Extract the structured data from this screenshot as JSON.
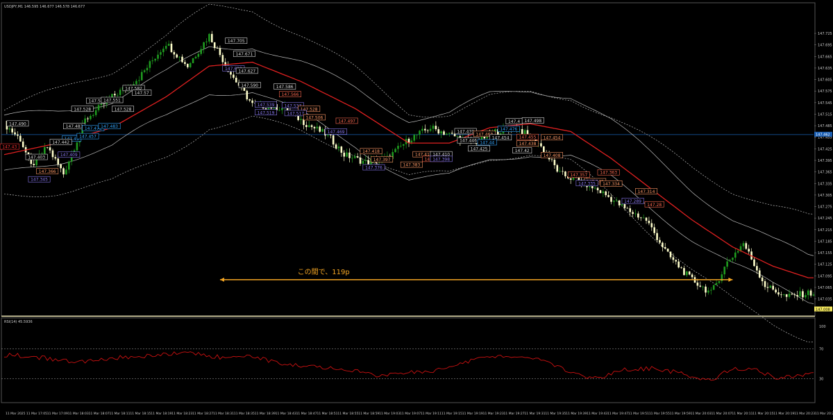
{
  "header": {
    "symbol_line": "USDJPY,M1  146.595 146.677 146.578 146.677",
    "rsi_label": "RSI(14) 45.5936"
  },
  "annotation": {
    "text": "この間で、119p"
  },
  "colors": {
    "background": "#000000",
    "bull": "#1f9b1f",
    "bear": "#ffffcc",
    "ma": "#e02020",
    "band": "#bdbdbd",
    "hline": "#1a5fb4",
    "annotation": "#f5a623",
    "rsi": "#cc1111"
  },
  "chart_data": [
    {
      "type": "candlestick",
      "title": "",
      "ylim": [
        147.0,
        147.79
      ],
      "price_ticks": [
        "147.725",
        "147.695",
        "147.665",
        "147.635",
        "147.605",
        "147.575",
        "147.545",
        "147.515",
        "147.485",
        "147.455",
        "147.425",
        "147.395",
        "147.365",
        "147.335",
        "147.305",
        "147.275",
        "147.245",
        "147.215",
        "147.185",
        "147.155",
        "147.125",
        "147.095",
        "147.065",
        "147.035"
      ],
      "hline": {
        "value": 147.462,
        "label": "147.462"
      },
      "current_price": {
        "value": 147.008,
        "label": "147.008"
      },
      "close_path": [
        [
          0,
          147.49
        ],
        [
          6,
          147.45
        ],
        [
          10,
          147.38
        ],
        [
          16,
          147.43
        ],
        [
          22,
          147.36
        ],
        [
          30,
          147.5
        ],
        [
          40,
          147.56
        ],
        [
          50,
          147.61
        ],
        [
          60,
          147.7
        ],
        [
          68,
          147.64
        ],
        [
          76,
          147.72
        ],
        [
          84,
          147.62
        ],
        [
          92,
          147.54
        ],
        [
          104,
          147.53
        ],
        [
          112,
          147.49
        ],
        [
          120,
          147.46
        ],
        [
          126,
          147.41
        ],
        [
          134,
          147.39
        ],
        [
          142,
          147.4
        ],
        [
          150,
          147.45
        ],
        [
          158,
          147.48
        ],
        [
          166,
          147.46
        ],
        [
          174,
          147.44
        ],
        [
          182,
          147.47
        ],
        [
          190,
          147.48
        ],
        [
          198,
          147.44
        ],
        [
          206,
          147.36
        ],
        [
          214,
          147.34
        ],
        [
          222,
          147.31
        ],
        [
          230,
          147.27
        ],
        [
          238,
          147.24
        ],
        [
          246,
          147.15
        ],
        [
          254,
          147.09
        ],
        [
          262,
          147.05
        ],
        [
          268,
          147.13
        ],
        [
          274,
          147.18
        ],
        [
          282,
          147.07
        ],
        [
          290,
          147.04
        ],
        [
          298,
          147.05
        ]
      ],
      "ma_path": [
        [
          0,
          147.41
        ],
        [
          20,
          147.44
        ],
        [
          40,
          147.48
        ],
        [
          60,
          147.56
        ],
        [
          76,
          147.64
        ],
        [
          92,
          147.65
        ],
        [
          110,
          147.6
        ],
        [
          130,
          147.53
        ],
        [
          150,
          147.44
        ],
        [
          165,
          147.44
        ],
        [
          180,
          147.48
        ],
        [
          195,
          147.49
        ],
        [
          210,
          147.47
        ],
        [
          225,
          147.4
        ],
        [
          240,
          147.32
        ],
        [
          255,
          147.24
        ],
        [
          270,
          147.17
        ],
        [
          285,
          147.12
        ],
        [
          298,
          147.09
        ]
      ],
      "labels": [
        {
          "i": 86,
          "v": 147.705,
          "text": "147.705",
          "c": "#dddddd"
        },
        {
          "i": 89,
          "v": 147.671,
          "text": "147.671",
          "c": "#dddddd"
        },
        {
          "i": 85,
          "v": 147.633,
          "text": "147.633",
          "c": "#8877ee"
        },
        {
          "i": 90,
          "v": 147.627,
          "text": "147.627",
          "c": "#dddddd"
        },
        {
          "i": 91,
          "v": 147.59,
          "text": "147.590",
          "c": "#dddddd"
        },
        {
          "i": 104,
          "v": 147.586,
          "text": "147.586",
          "c": "#dddddd"
        },
        {
          "i": 106,
          "v": 147.566,
          "text": "147.566",
          "c": "#ff6a50"
        },
        {
          "i": 97,
          "v": 147.539,
          "text": "147.539",
          "c": "#8877ee"
        },
        {
          "i": 107,
          "v": 147.537,
          "text": "147.537",
          "c": "#8877ee"
        },
        {
          "i": 97,
          "v": 147.519,
          "text": "147.519",
          "c": "#8877ee"
        },
        {
          "i": 113,
          "v": 147.528,
          "text": "147.528",
          "c": "#ff9966"
        },
        {
          "i": 108,
          "v": 147.517,
          "text": "147.517",
          "c": "#8877ee"
        },
        {
          "i": 115,
          "v": 147.506,
          "text": "147.506",
          "c": "#ff9966"
        },
        {
          "i": 127,
          "v": 147.497,
          "text": "147.497",
          "c": "#ff6a50"
        },
        {
          "i": 123,
          "v": 147.469,
          "text": "147.469",
          "c": "#8877ee"
        },
        {
          "i": 136,
          "v": 147.418,
          "text": "147.418",
          "c": "#ff9966"
        },
        {
          "i": 140,
          "v": 147.397,
          "text": "147.397",
          "c": "#ff9966"
        },
        {
          "i": 137,
          "v": 147.376,
          "text": "147.376",
          "c": "#8877ee"
        },
        {
          "i": 155,
          "v": 147.41,
          "text": "147.41",
          "c": "#ff9966"
        },
        {
          "i": 162,
          "v": 147.41,
          "text": "147.410",
          "c": "#dddddd"
        },
        {
          "i": 159,
          "v": 147.398,
          "text": "147.398",
          "c": "#ff6a50"
        },
        {
          "i": 162,
          "v": 147.398,
          "text": "147.398",
          "c": "#8877ee"
        },
        {
          "i": 151,
          "v": 147.383,
          "text": "147.383",
          "c": "#ff9966"
        },
        {
          "i": 171,
          "v": 147.47,
          "text": "147.470",
          "c": "#dddddd"
        },
        {
          "i": 172,
          "v": 147.446,
          "text": "147.446",
          "c": "#dddddd"
        },
        {
          "i": 178,
          "v": 147.463,
          "text": "147.463",
          "c": "#ff9966"
        },
        {
          "i": 187,
          "v": 147.476,
          "text": "147.476",
          "c": "#33a6ff"
        },
        {
          "i": 184,
          "v": 147.454,
          "text": "147.454",
          "c": "#dddddd"
        },
        {
          "i": 179,
          "v": 147.441,
          "text": "147.44",
          "c": "#33a6ff"
        },
        {
          "i": 176,
          "v": 147.425,
          "text": "147.425",
          "c": "#dddddd"
        },
        {
          "i": 192,
          "v": 147.42,
          "text": "147.42",
          "c": "#dddddd"
        },
        {
          "i": 189,
          "v": 147.496,
          "text": "147.4",
          "c": "#dddddd"
        },
        {
          "i": 196,
          "v": 147.498,
          "text": "147.498",
          "c": "#dddddd"
        },
        {
          "i": 194,
          "v": 147.455,
          "text": "147.455",
          "c": "#ff6a50"
        },
        {
          "i": 203,
          "v": 147.454,
          "text": "147.454",
          "c": "#ff9966"
        },
        {
          "i": 194,
          "v": 147.438,
          "text": "147.438",
          "c": "#ff9966"
        },
        {
          "i": 203,
          "v": 147.408,
          "text": "147.408",
          "c": "#ff9966"
        },
        {
          "i": 213,
          "v": 147.357,
          "text": "147.357",
          "c": "#ff6a50"
        },
        {
          "i": 224,
          "v": 147.363,
          "text": "147.363",
          "c": "#ff6a50"
        },
        {
          "i": 219,
          "v": 147.34,
          "text": "147.340",
          "c": "#ff9966"
        },
        {
          "i": 225,
          "v": 147.334,
          "text": "147.334",
          "c": "#ff9966"
        },
        {
          "i": 216,
          "v": 147.335,
          "text": "147.335",
          "c": "#8877ee"
        },
        {
          "i": 238,
          "v": 147.314,
          "text": "147.314",
          "c": "#ff9966"
        },
        {
          "i": 233,
          "v": 147.289,
          "text": "147.289",
          "c": "#8877ee"
        },
        {
          "i": 241,
          "v": 147.28,
          "text": "147.28",
          "c": "#ff6a50"
        },
        {
          "i": 29,
          "v": 147.528,
          "text": "147.528",
          "c": "#dddddd"
        },
        {
          "i": 34,
          "v": 147.549,
          "text": "147.54",
          "c": "#dddddd"
        },
        {
          "i": 40,
          "v": 147.551,
          "text": "147.551",
          "c": "#dddddd"
        },
        {
          "i": 48,
          "v": 147.582,
          "text": "147.582",
          "c": "#dddddd"
        },
        {
          "i": 51,
          "v": 147.57,
          "text": "147.57",
          "c": "#dddddd"
        },
        {
          "i": 44,
          "v": 147.528,
          "text": "147.528",
          "c": "#dddddd"
        },
        {
          "i": 26,
          "v": 147.483,
          "text": "147.483",
          "c": "#dddddd"
        },
        {
          "i": 33,
          "v": 147.478,
          "text": "147.478",
          "c": "#33a6ff"
        },
        {
          "i": 39,
          "v": 147.483,
          "text": "147.483",
          "c": "#33a6ff"
        },
        {
          "i": 25,
          "v": 147.451,
          "text": "147.45",
          "c": "#33a6ff"
        },
        {
          "i": 31,
          "v": 147.457,
          "text": "147.457",
          "c": "#33a6ff"
        },
        {
          "i": 21,
          "v": 147.442,
          "text": "147.442",
          "c": "#dddddd"
        },
        {
          "i": 12,
          "v": 147.403,
          "text": "147.403",
          "c": "#dddddd"
        },
        {
          "i": 24,
          "v": 147.409,
          "text": "147.409",
          "c": "#8877ee"
        },
        {
          "i": 5,
          "v": 147.49,
          "text": "147.490",
          "c": "#dddddd"
        },
        {
          "i": 2,
          "v": 147.43,
          "text": "147.43",
          "c": "#ff3030"
        },
        {
          "i": 16,
          "v": 147.366,
          "text": "147.366",
          "c": "#ff9966"
        },
        {
          "i": 13,
          "v": 147.345,
          "text": "147.345",
          "c": "#8877ee"
        }
      ],
      "annotation_range": {
        "from_i": 80,
        "to_i": 270,
        "value": 147.085
      },
      "time_ticks": [
        "11 Mar 2025",
        "11 Mar 17:05",
        "11 Mar 17:09",
        "11 Mar 18:03",
        "11 Mar 18:07",
        "11 Mar 18:11",
        "11 Mar 18:15",
        "11 Mar 18:19",
        "11 Mar 18:23",
        "11 Mar 18:27",
        "11 Mar 18:31",
        "11 Mar 18:35",
        "11 Mar 18:39",
        "11 Mar 18:43",
        "11 Mar 18:47",
        "11 Mar 18:51",
        "11 Mar 18:55",
        "11 Mar 18:59",
        "11 Mar 19:03",
        "11 Mar 19:07",
        "11 Mar 19:11",
        "11 Mar 19:15",
        "11 Mar 19:19",
        "11 Mar 19:23",
        "11 Mar 19:27",
        "11 Mar 19:31",
        "11 Mar 19:35",
        "11 Mar 19:39",
        "11 Mar 19:43",
        "11 Mar 19:47",
        "11 Mar 19:51",
        "11 Mar 19:55",
        "11 Mar 19:59",
        "11 Mar 20:03",
        "11 Mar 20:07",
        "11 Mar 20:11",
        "11 Mar 20:15",
        "11 Mar 20:19",
        "11 Mar 20:23",
        "11 Mar 20:27"
      ]
    },
    {
      "type": "line",
      "title": "",
      "ylim": [
        0,
        100
      ],
      "levels": [
        70,
        30
      ],
      "y_ticks": [
        "100",
        "70",
        "30"
      ],
      "rsi_path": [
        [
          0,
          62
        ],
        [
          10,
          60
        ],
        [
          20,
          55
        ],
        [
          30,
          52
        ],
        [
          40,
          58
        ],
        [
          50,
          60
        ],
        [
          60,
          62
        ],
        [
          68,
          66
        ],
        [
          76,
          60
        ],
        [
          84,
          58
        ],
        [
          92,
          60
        ],
        [
          100,
          52
        ],
        [
          110,
          48
        ],
        [
          120,
          44
        ],
        [
          130,
          40
        ],
        [
          140,
          34
        ],
        [
          150,
          38
        ],
        [
          160,
          40
        ],
        [
          170,
          52
        ],
        [
          180,
          60
        ],
        [
          190,
          58
        ],
        [
          200,
          56
        ],
        [
          210,
          38
        ],
        [
          220,
          30
        ],
        [
          230,
          42
        ],
        [
          240,
          44
        ],
        [
          250,
          38
        ],
        [
          262,
          28
        ],
        [
          270,
          45
        ],
        [
          278,
          42
        ],
        [
          286,
          32
        ],
        [
          294,
          33
        ],
        [
          300,
          38
        ]
      ]
    }
  ]
}
